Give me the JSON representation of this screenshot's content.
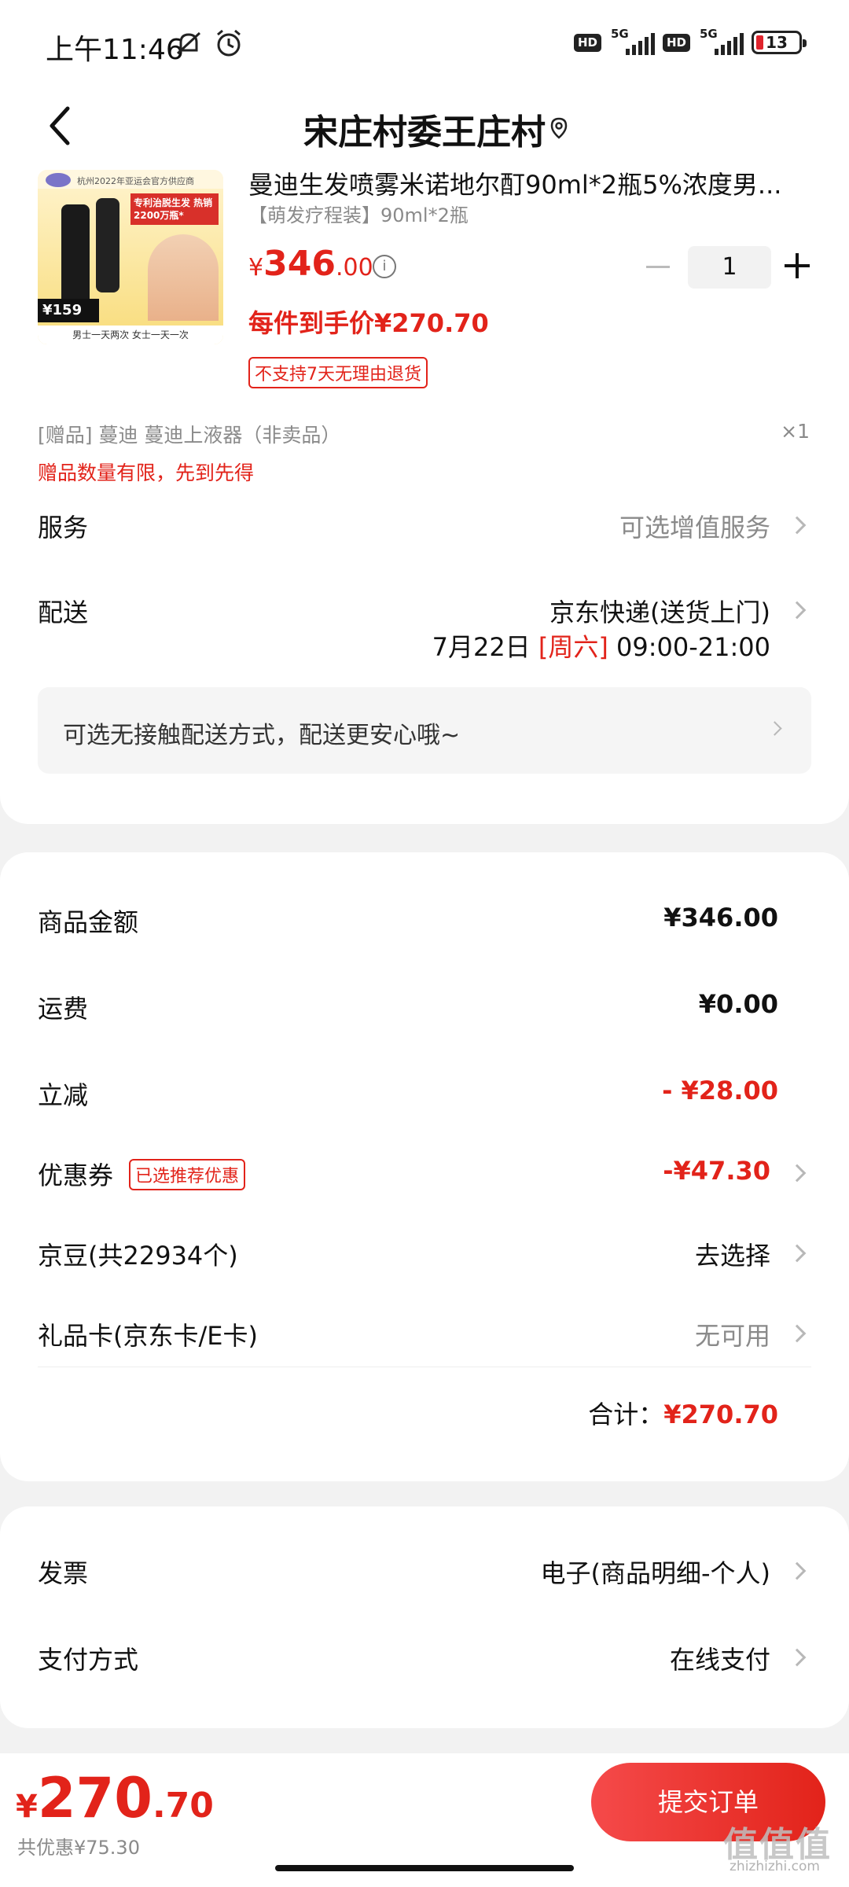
{
  "status_bar": {
    "time": "上午11:46",
    "network": "5G",
    "hd": "HD",
    "battery": "13"
  },
  "nav": {
    "title": "宋庄村委王庄村"
  },
  "product": {
    "image_text": {
      "header": "杭州2022年亚运会官方供应商",
      "tag": "专利治脱生发 热销2200万瓶*",
      "price": "¥159",
      "footer": "男士一天两次 女士一天一次"
    },
    "name": "曼迪生发喷雾米诺地尔酊90ml*2瓶5%浓度男...",
    "spec": "【萌发疗程装】90ml*2瓶",
    "price_yen": "¥",
    "price_int": "346",
    "price_dec": ".00",
    "quantity": "1",
    "unit_price": "每件到手价¥270.70",
    "no_return": "不支持7天无理由退货"
  },
  "gift": {
    "line": "[赠品]  蔓迪 蔓迪上液器（非卖品）",
    "qty": "×1",
    "note": "赠品数量有限，先到先得"
  },
  "service": {
    "label": "服务",
    "value": "可选增值服务"
  },
  "delivery": {
    "label": "配送",
    "value": "京东快递(送货上门)",
    "date": "7月22日",
    "weekday": "[周六]",
    "time_window": "09:00-21:00",
    "contactless": "可选无接触配送方式，配送更安心哦~"
  },
  "summary": {
    "goods_label": "商品金额",
    "goods_value": "¥346.00",
    "shipping_label": "运费",
    "shipping_value": "¥0.00",
    "discount_label": "立减",
    "discount_value": "- ¥28.00",
    "coupon_label": "优惠券",
    "coupon_badge": "已选推荐优惠",
    "coupon_value": "-¥47.30",
    "jingdou_label": "京豆(共22934个)",
    "jingdou_value": "去选择",
    "giftcard_label": "礼品卡(京东卡/E卡)",
    "giftcard_value": "无可用",
    "total_label": "合计：",
    "total_value": "¥270.70"
  },
  "invoice": {
    "label": "发票",
    "value": "电子(商品明细-个人)",
    "payment_label": "支付方式",
    "payment_value": "在线支付"
  },
  "bottom": {
    "price_yen": "¥",
    "price_int": "270",
    "price_dec": ".70",
    "savings": "共优惠¥75.30",
    "submit": "提交订单",
    "watermark": "值值值",
    "watermark_url": "zhizhizhi.com"
  },
  "colors": {
    "accent_red": "#e2231a",
    "background": "#f2f2f2"
  }
}
